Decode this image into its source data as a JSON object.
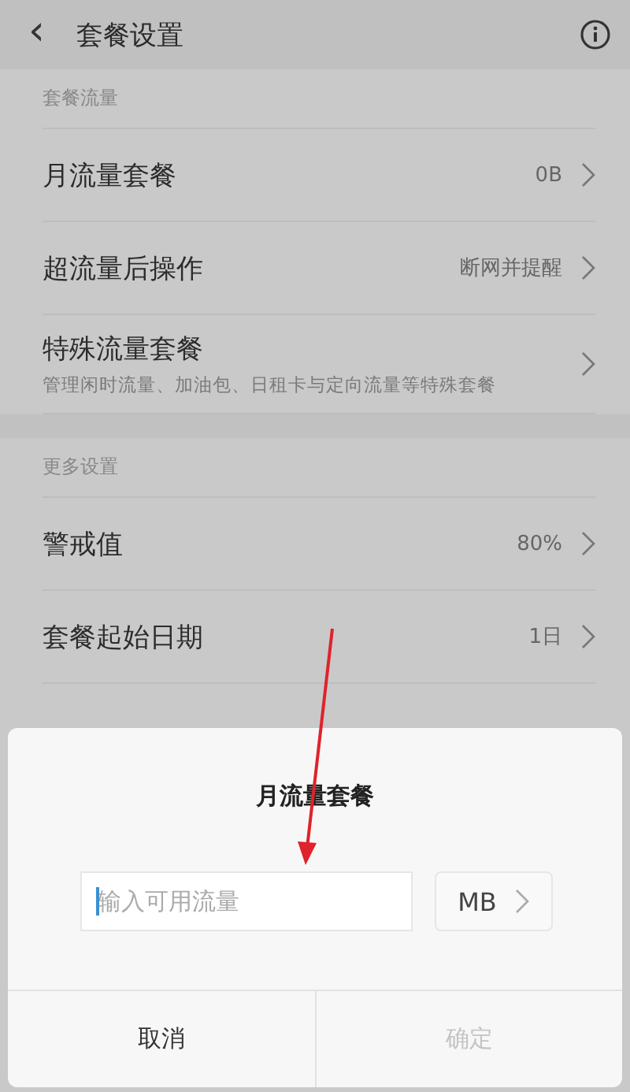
{
  "header": {
    "back": "‹",
    "title": "套餐设置"
  },
  "sections": [
    {
      "title": "套餐流量",
      "rows": [
        {
          "label": "月流量套餐",
          "value": "0B"
        },
        {
          "label": "超流量后操作",
          "value": "断网并提醒"
        },
        {
          "label": "特殊流量套餐",
          "subtitle": "管理闲时流量、加油包、日租卡与定向流量等特殊套餐"
        }
      ]
    },
    {
      "title": "更多设置",
      "rows": [
        {
          "label": "警戒值",
          "value": "80%"
        },
        {
          "label": "套餐起始日期",
          "value": "1日"
        }
      ]
    }
  ],
  "dialog": {
    "title": "月流量套餐",
    "input": {
      "placeholder": "输入可用流量",
      "focused": true
    },
    "unit": "MB",
    "buttons": [
      {
        "label": "取消",
        "disabled": false
      },
      {
        "label": "确定",
        "disabled": true
      }
    ]
  }
}
